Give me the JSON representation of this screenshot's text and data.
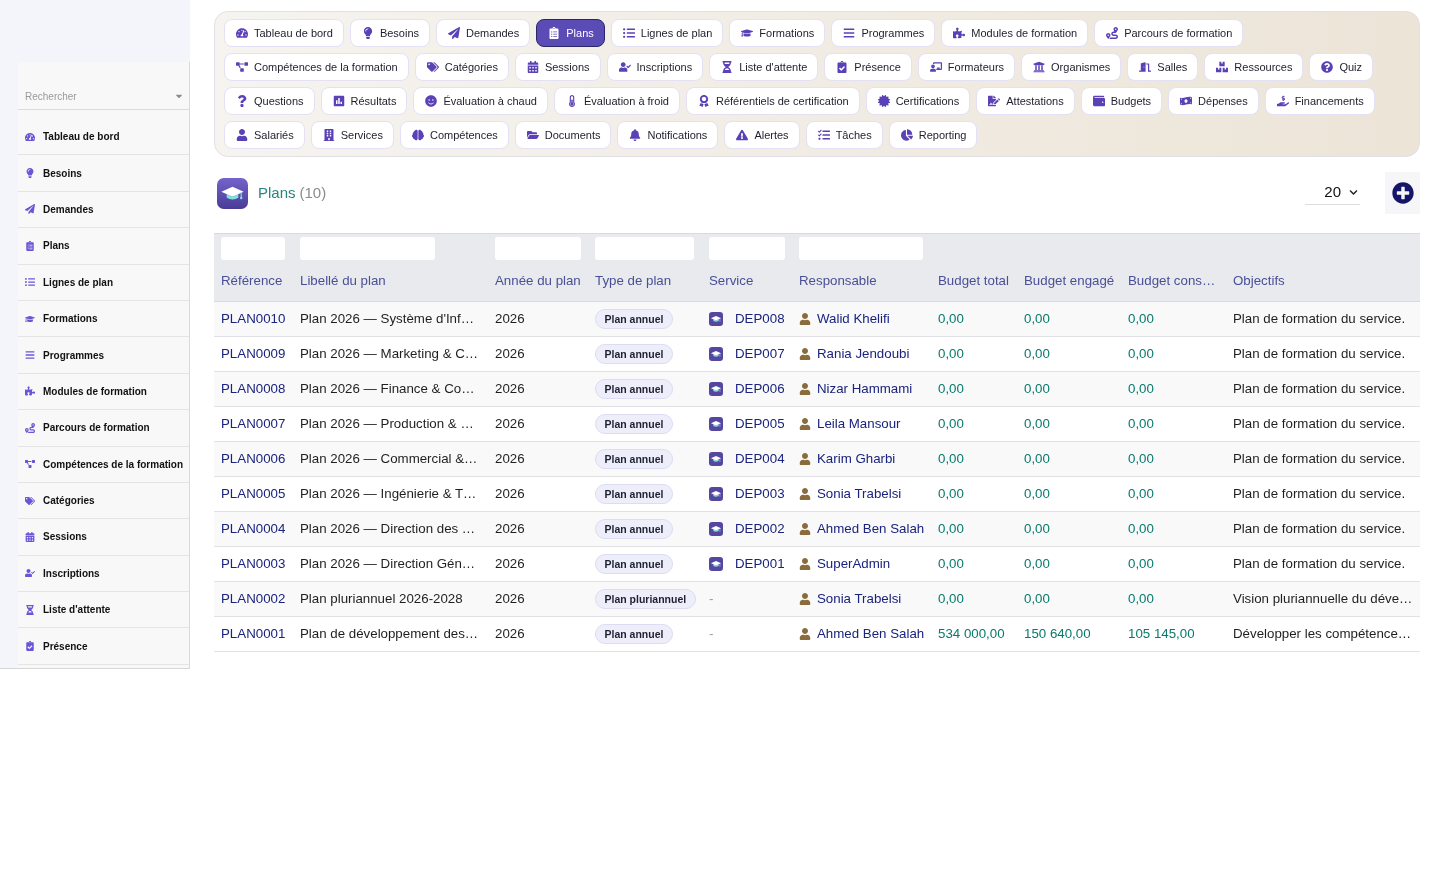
{
  "sidebar": {
    "search": {
      "placeholder": "Rechercher"
    },
    "items": [
      {
        "label": "Tableau de bord",
        "selected": false
      },
      {
        "label": "Besoins",
        "selected": false
      },
      {
        "label": "Demandes",
        "selected": false
      },
      {
        "label": "Plans",
        "selected": false
      },
      {
        "label": "Lignes de plan",
        "selected": false
      },
      {
        "label": "Formations",
        "selected": false
      },
      {
        "label": "Programmes",
        "selected": false
      },
      {
        "label": "Modules de formation",
        "selected": false
      },
      {
        "label": "Parcours de formation",
        "selected": false
      },
      {
        "label": "Compétences de la formation",
        "selected": false
      },
      {
        "label": "Catégories",
        "selected": false
      },
      {
        "label": "Sessions",
        "selected": false
      },
      {
        "label": "Inscriptions",
        "selected": false
      },
      {
        "label": "Liste d'attente",
        "selected": false
      },
      {
        "label": "Présence",
        "selected": false
      }
    ]
  },
  "nav_tabs": [
    {
      "label": "Tableau de bord",
      "selected": false
    },
    {
      "label": "Besoins",
      "selected": false
    },
    {
      "label": "Demandes",
      "selected": false
    },
    {
      "label": "Plans",
      "selected": true
    },
    {
      "label": "Lignes de plan",
      "selected": false
    },
    {
      "label": "Formations",
      "selected": false
    },
    {
      "label": "Programmes",
      "selected": false
    },
    {
      "label": "Modules de formation",
      "selected": false
    },
    {
      "label": "Parcours de formation",
      "selected": false
    },
    {
      "label": "Compétences de la formation",
      "selected": false
    },
    {
      "label": "Catégories",
      "selected": false
    },
    {
      "label": "Sessions",
      "selected": false
    },
    {
      "label": "Inscriptions",
      "selected": false
    },
    {
      "label": "Liste d'attente",
      "selected": false
    },
    {
      "label": "Présence",
      "selected": false
    },
    {
      "label": "Formateurs",
      "selected": false
    },
    {
      "label": "Organismes",
      "selected": false
    },
    {
      "label": "Salles",
      "selected": false
    },
    {
      "label": "Ressources",
      "selected": false
    },
    {
      "label": "Quiz",
      "selected": false
    },
    {
      "label": "Questions",
      "selected": false
    },
    {
      "label": "Résultats",
      "selected": false
    },
    {
      "label": "Évaluation à chaud",
      "selected": false
    },
    {
      "label": "Évaluation à froid",
      "selected": false
    },
    {
      "label": "Référentiels de certification",
      "selected": false
    },
    {
      "label": "Certifications",
      "selected": false
    },
    {
      "label": "Attestations",
      "selected": false
    },
    {
      "label": "Budgets",
      "selected": false
    },
    {
      "label": "Dépenses",
      "selected": false
    },
    {
      "label": "Financements",
      "selected": false
    },
    {
      "label": "Salariés",
      "selected": false
    },
    {
      "label": "Services",
      "selected": false
    },
    {
      "label": "Compétences",
      "selected": false
    },
    {
      "label": "Documents",
      "selected": false
    },
    {
      "label": "Notifications",
      "selected": false
    },
    {
      "label": "Alertes",
      "selected": false
    },
    {
      "label": "Tâches",
      "selected": false
    },
    {
      "label": "Reporting",
      "selected": false
    }
  ],
  "page_header": {
    "title": "Plans",
    "count": "(10)",
    "page_size": "20"
  },
  "table": {
    "columns": [
      {
        "label": "Référence",
        "filter": true
      },
      {
        "label": "Libellé du plan",
        "filter": true
      },
      {
        "label": "Année du plan",
        "filter": true
      },
      {
        "label": "Type de plan",
        "filter": true
      },
      {
        "label": "Service",
        "filter": true
      },
      {
        "label": "Responsable",
        "filter": true
      },
      {
        "label": "Budget total",
        "filter": false
      },
      {
        "label": "Budget engagé",
        "filter": false
      },
      {
        "label": "Budget cons…",
        "filter": false
      },
      {
        "label": "Objectifs",
        "filter": false
      }
    ],
    "rows": [
      {
        "reference": "PLAN0010",
        "label": "Plan 2026 — Système d'Inf…",
        "year": "2026",
        "type": "Plan annuel",
        "service": {
          "kind": "department",
          "text": "DEP008"
        },
        "responsible": "Walid Khelifi",
        "budget_total": "0,00",
        "budget_engaged": "0,00",
        "budget_consumed": "0,00",
        "objectives": "Plan de formation du service."
      },
      {
        "reference": "PLAN0009",
        "label": "Plan 2026 — Marketing & C…",
        "year": "2026",
        "type": "Plan annuel",
        "service": {
          "kind": "department",
          "text": "DEP007"
        },
        "responsible": "Rania Jendoubi",
        "budget_total": "0,00",
        "budget_engaged": "0,00",
        "budget_consumed": "0,00",
        "objectives": "Plan de formation du service."
      },
      {
        "reference": "PLAN0008",
        "label": "Plan 2026 — Finance & Co…",
        "year": "2026",
        "type": "Plan annuel",
        "service": {
          "kind": "department",
          "text": "DEP006"
        },
        "responsible": "Nizar Hammami",
        "budget_total": "0,00",
        "budget_engaged": "0,00",
        "budget_consumed": "0,00",
        "objectives": "Plan de formation du service."
      },
      {
        "reference": "PLAN0007",
        "label": "Plan 2026 — Production & …",
        "year": "2026",
        "type": "Plan annuel",
        "service": {
          "kind": "department",
          "text": "DEP005"
        },
        "responsible": "Leila Mansour",
        "budget_total": "0,00",
        "budget_engaged": "0,00",
        "budget_consumed": "0,00",
        "objectives": "Plan de formation du service."
      },
      {
        "reference": "PLAN0006",
        "label": "Plan 2026 — Commercial &…",
        "year": "2026",
        "type": "Plan annuel",
        "service": {
          "kind": "department",
          "text": "DEP004"
        },
        "responsible": "Karim Gharbi",
        "budget_total": "0,00",
        "budget_engaged": "0,00",
        "budget_consumed": "0,00",
        "objectives": "Plan de formation du service."
      },
      {
        "reference": "PLAN0005",
        "label": "Plan 2026 — Ingénierie & T…",
        "year": "2026",
        "type": "Plan annuel",
        "service": {
          "kind": "department",
          "text": "DEP003"
        },
        "responsible": "Sonia Trabelsi",
        "budget_total": "0,00",
        "budget_engaged": "0,00",
        "budget_consumed": "0,00",
        "objectives": "Plan de formation du service."
      },
      {
        "reference": "PLAN0004",
        "label": "Plan 2026 — Direction des …",
        "year": "2026",
        "type": "Plan annuel",
        "service": {
          "kind": "department",
          "text": "DEP002"
        },
        "responsible": "Ahmed Ben Salah",
        "budget_total": "0,00",
        "budget_engaged": "0,00",
        "budget_consumed": "0,00",
        "objectives": "Plan de formation du service."
      },
      {
        "reference": "PLAN0003",
        "label": "Plan 2026 — Direction Gén…",
        "year": "2026",
        "type": "Plan annuel",
        "service": {
          "kind": "department",
          "text": "DEP001"
        },
        "responsible": "SuperAdmin",
        "budget_total": "0,00",
        "budget_engaged": "0,00",
        "budget_consumed": "0,00",
        "objectives": "Plan de formation du service."
      },
      {
        "reference": "PLAN0002",
        "label": "Plan pluriannuel 2026-2028",
        "year": "2026",
        "type": "Plan pluriannuel",
        "service": {
          "kind": "empty",
          "text": "-"
        },
        "responsible": "Sonia Trabelsi",
        "budget_total": "0,00",
        "budget_engaged": "0,00",
        "budget_consumed": "0,00",
        "objectives": "Vision pluriannuelle du déve…"
      },
      {
        "reference": "PLAN0001",
        "label": "Plan de développement des…",
        "year": "2026",
        "type": "Plan annuel",
        "service": {
          "kind": "empty",
          "text": "-"
        },
        "responsible": "Ahmed Ben Salah",
        "budget_total": "534 000,00",
        "budget_engaged": "150 640,00",
        "budget_consumed": "105 145,00",
        "objectives": "Développer les compétence…"
      }
    ]
  }
}
